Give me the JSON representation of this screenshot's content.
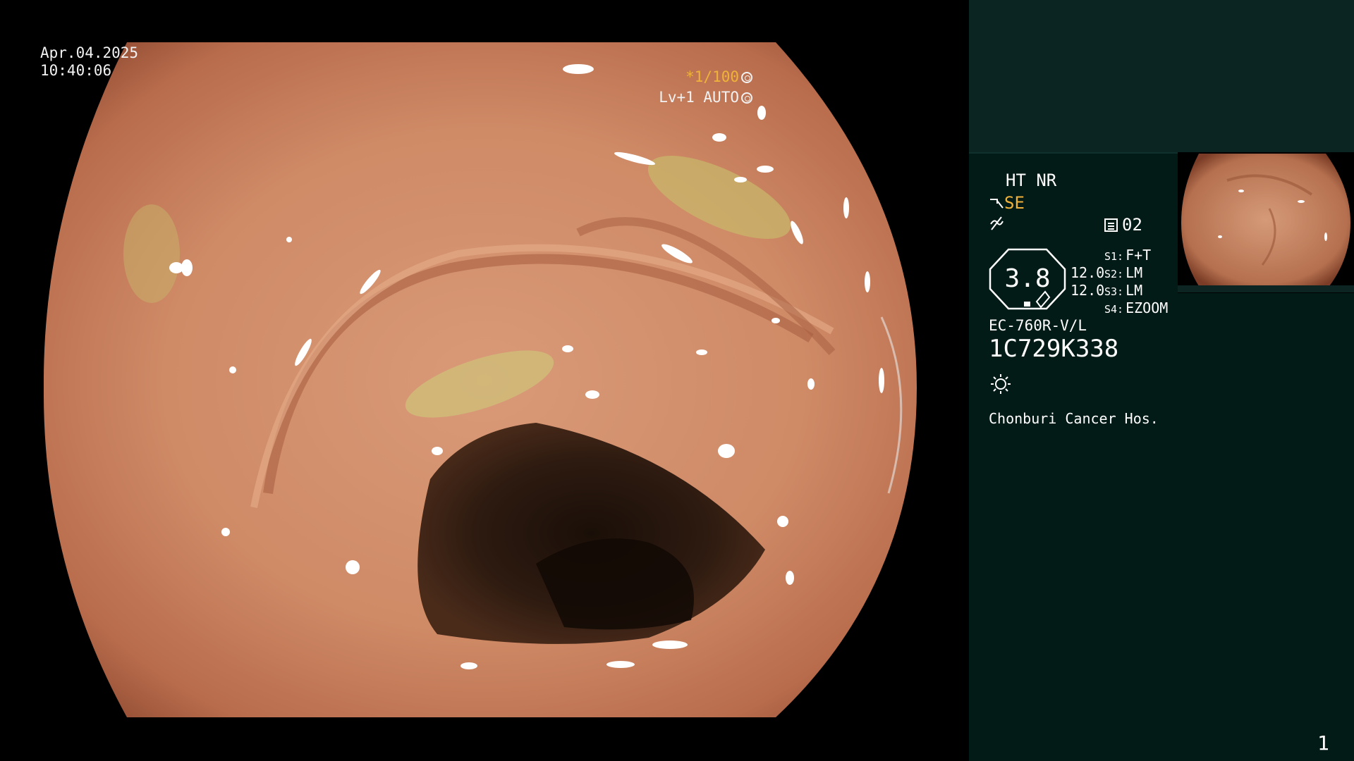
{
  "overlay": {
    "date": "Apr.04.2025",
    "time": "10:40:06",
    "shutter": "*1/100",
    "iris": "Lv+1 AUTO"
  },
  "panel": {
    "ht_nr": "HT NR",
    "se": "SE",
    "memo": "02",
    "zoom_value": "3.8",
    "gain_1": "12.0",
    "gain_2": "12.0",
    "switches": [
      {
        "key": "S1:",
        "value": "F+T"
      },
      {
        "key": "S2:",
        "value": "LM"
      },
      {
        "key": "S3:",
        "value": "LM"
      },
      {
        "key": "S4:",
        "value": "EZOOM"
      }
    ],
    "scope_model": "EC-760R-V/L",
    "serial": "1C729K338",
    "hospital": "Chonburi Cancer Hos.",
    "page_number": "1"
  },
  "icons": [
    "shutter-icon",
    "iris-icon",
    "scope-icon",
    "freeze-icon",
    "memo-icon",
    "light-icon"
  ],
  "colors": {
    "panel_bg": "#031b17",
    "accent": "#f0b23a"
  }
}
